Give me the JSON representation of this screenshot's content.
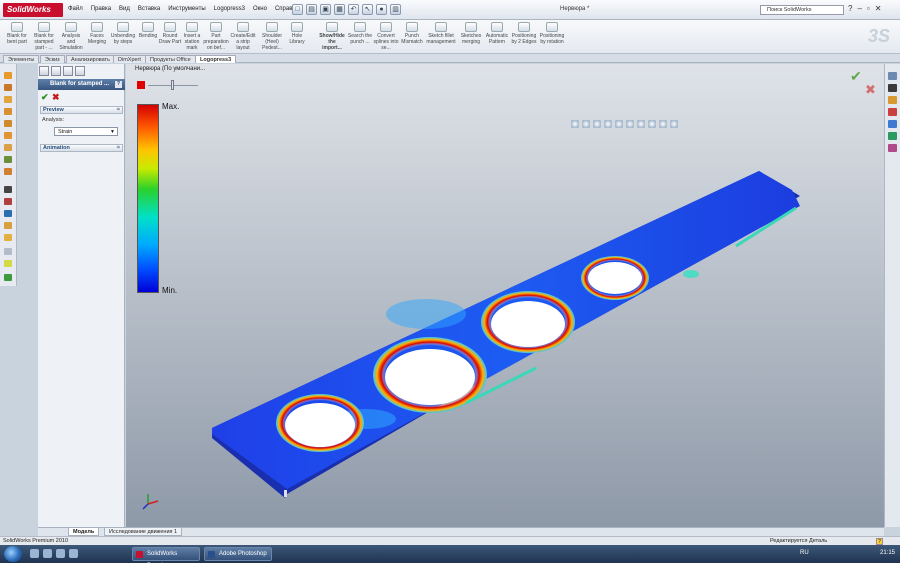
{
  "app": {
    "logo": "SolidWorks",
    "menus": [
      "Файл",
      "Правка",
      "Вид",
      "Вставка",
      "Инструменты",
      "Logopress3",
      "Окно",
      "Справка"
    ],
    "document_title": "Нервюра *",
    "search_placeholder": "Поиск SolidWorks"
  },
  "command_manager": {
    "items": [
      "Blank for bent part",
      "Blank for stamped part - ...",
      "Analysis and Simulation",
      "Faces Merging",
      "Unbending by steps",
      "Bending",
      "Round Draw Part",
      "Insert a station mark",
      "Part preparation on bef...",
      "Create/Edit a strip layout",
      "Shoulder (Heel) Pedest...",
      "Hole Library",
      "Show/Hide the import...",
      "Search the punch ...",
      "Convert splines into se...",
      "Punch Mismatch",
      "Sketch fillet management",
      "Sketches merging",
      "Automatic Pattern",
      "Positioning by 2 Edges",
      "Positioning by rotation"
    ]
  },
  "tabs": [
    "Элементы",
    "Эскиз",
    "Анализировать",
    "DimXpert",
    "Продукты Office",
    "Logopress3"
  ],
  "active_tab": "Logopress3",
  "property_manager": {
    "title": "Blank for stamped ...",
    "help": "?",
    "ok": "✔",
    "cancel": "✖",
    "preview_label": "Preview",
    "analysis_label": "Analysis:",
    "analysis_value": "Strain",
    "animation_label": "Animation"
  },
  "viewport": {
    "tree_text": "Нервюра  (По умолчани...",
    "legend_max": "Max.",
    "legend_min": "Min."
  },
  "bottom_tabs": [
    "Модель",
    "Исследование движения 1"
  ],
  "status": {
    "left": "SolidWorks Premium 2010",
    "right": "Редактируется Деталь",
    "help": "?"
  },
  "taskbar": {
    "tasks": [
      "SolidWorks Premiu...",
      "Adobe Photoshop"
    ],
    "language": "RU",
    "time": "21:15"
  }
}
